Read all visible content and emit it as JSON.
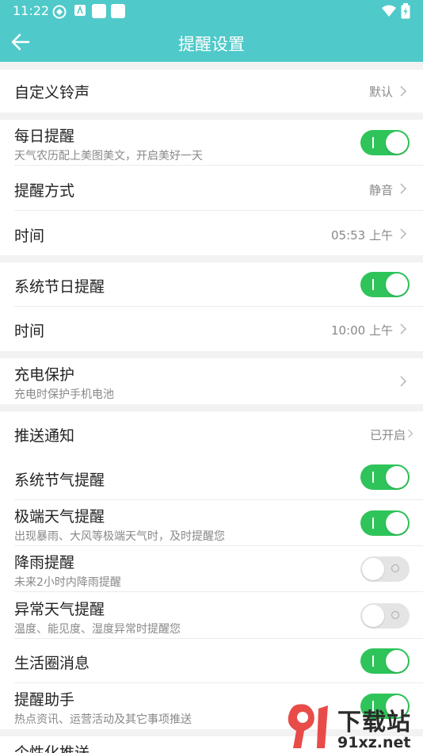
{
  "status_bar": {
    "time": "11:22"
  },
  "header": {
    "title": "提醒设置"
  },
  "rows": {
    "ringtone": {
      "label": "自定义铃声",
      "value": "默认"
    },
    "daily": {
      "label": "每日提醒",
      "sub": "天气农历配上美图美文，开启美好一天",
      "enabled": true
    },
    "method": {
      "label": "提醒方式",
      "value": "静音"
    },
    "daily_time": {
      "label": "时间",
      "value": "05:53 上午"
    },
    "holiday": {
      "label": "系统节日提醒",
      "enabled": true
    },
    "holiday_time": {
      "label": "时间",
      "value": "10:00 上午"
    },
    "charging": {
      "label": "充电保护",
      "sub": "充电时保护手机电池"
    },
    "push": {
      "label": "推送通知",
      "value": "已开启"
    },
    "solar_terms": {
      "label": "系统节气提醒",
      "enabled": true
    },
    "extreme": {
      "label": "极端天气提醒",
      "sub": "出现暴雨、大风等极端天气时，及时提醒您",
      "enabled": true
    },
    "rain": {
      "label": "降雨提醒",
      "sub": "未来2小时内降雨提醒",
      "enabled": false
    },
    "abnormal": {
      "label": "异常天气提醒",
      "sub": "温度、能见度、湿度异常时提醒您",
      "enabled": false
    },
    "community": {
      "label": "生活圈消息",
      "enabled": true
    },
    "assistant": {
      "label": "提醒助手",
      "sub": "热点资讯、运营活动及其它事项推送",
      "enabled": true
    },
    "personalized": {
      "label": "个性化推送"
    }
  },
  "watermark": {
    "text": "下载站",
    "domain": "91xz.net"
  },
  "colors": {
    "primary": "#4fc9c9",
    "toggle_on": "#2ec45a",
    "toggle_off": "#e4e4e4"
  }
}
